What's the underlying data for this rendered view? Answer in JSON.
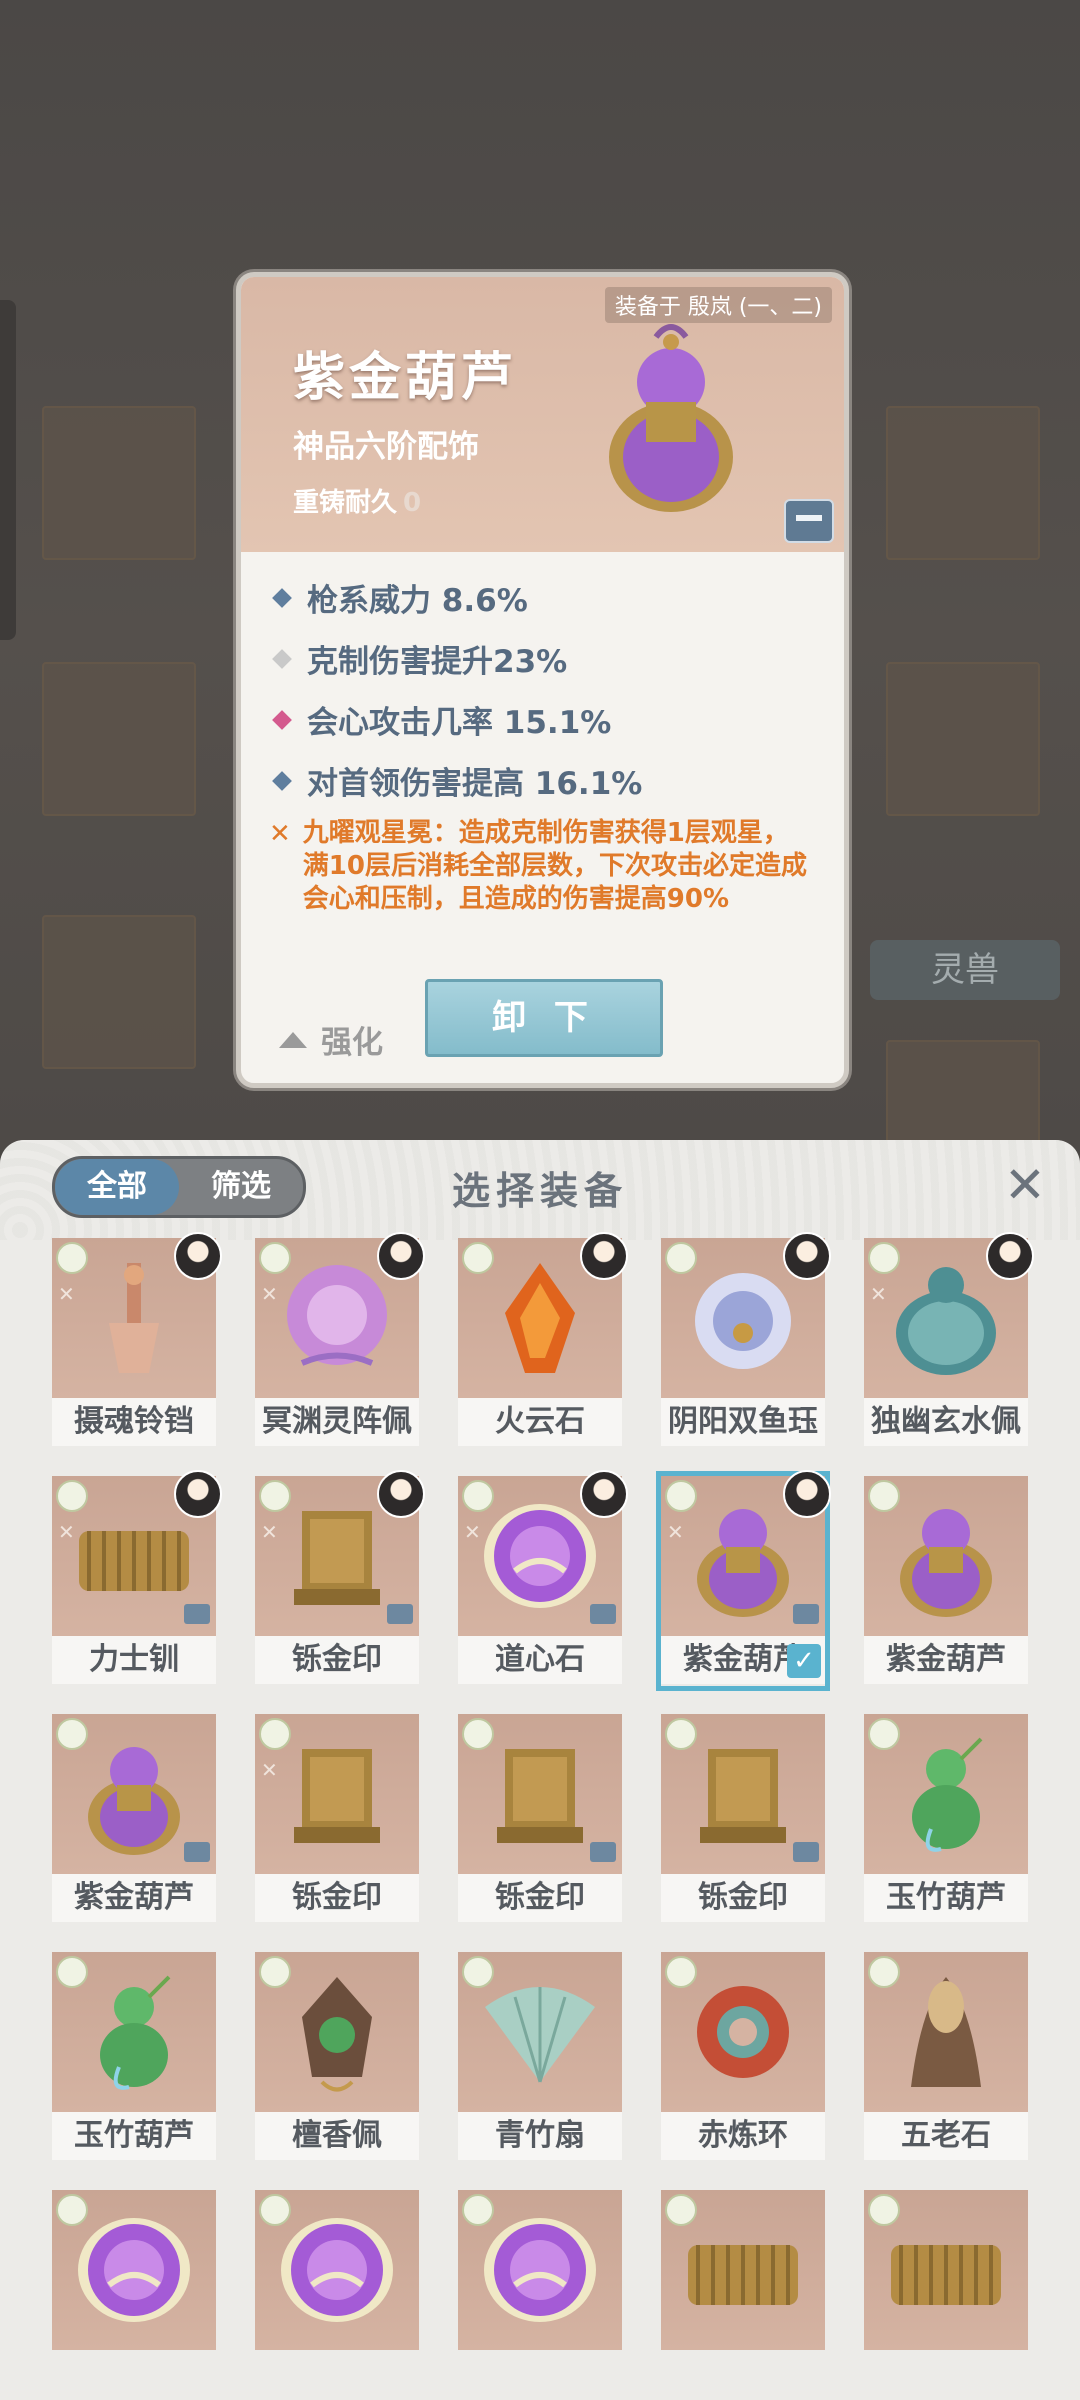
{
  "background": {
    "side_button_label": "灵兽"
  },
  "detail": {
    "equipped_by": "装备于 殷岚 (一、二)",
    "name": "紫金葫芦",
    "grade": "神品六阶配饰",
    "durability_label": "重铸耐久",
    "durability_value": "0",
    "stats": [
      {
        "text": "枪系威力 8.6%",
        "color": "#5f7e9e"
      },
      {
        "text": "克制伤害提升23%",
        "color": "#c9c9c9"
      },
      {
        "text": "会心攻击几率 15.1%",
        "color": "#d45a8e"
      },
      {
        "text": "对首领伤害提高 16.1%",
        "color": "#5f7e9e"
      }
    ],
    "set_effect": "九曜观星冕：造成克制伤害获得1层观星，满10层后消耗全部层数，下次攻击必定造成会心和压制，且造成的伤害提高90%",
    "enhance_label": "强化",
    "unequip_label": "卸 下"
  },
  "panel": {
    "tabs": [
      "全部",
      "筛选"
    ],
    "title": "选择装备",
    "close_icon": "close-icon",
    "items": [
      {
        "label": "摄魂铃铛",
        "art": "bell",
        "char": true,
        "mark": true,
        "lock": false,
        "selected": false
      },
      {
        "label": "冥渊灵阵佩",
        "art": "gear",
        "char": true,
        "mark": true,
        "lock": false,
        "selected": false
      },
      {
        "label": "火云石",
        "art": "fire",
        "char": true,
        "mark": false,
        "lock": false,
        "selected": false
      },
      {
        "label": "阴阳双鱼珏",
        "art": "yinyang",
        "char": true,
        "mark": false,
        "lock": false,
        "selected": false
      },
      {
        "label": "独幽玄水佩",
        "art": "jar",
        "char": true,
        "mark": true,
        "lock": false,
        "selected": false
      },
      {
        "label": "力士钏",
        "art": "spring",
        "char": true,
        "mark": true,
        "lock": true,
        "selected": false
      },
      {
        "label": "铄金印",
        "art": "seal",
        "char": true,
        "mark": true,
        "lock": true,
        "selected": false
      },
      {
        "label": "道心石",
        "art": "orb",
        "char": true,
        "mark": true,
        "lock": true,
        "selected": false
      },
      {
        "label": "紫金葫芦",
        "art": "gourd",
        "char": true,
        "mark": true,
        "lock": true,
        "selected": true
      },
      {
        "label": "紫金葫芦",
        "art": "gourd",
        "char": false,
        "mark": false,
        "lock": false,
        "selected": false
      },
      {
        "label": "紫金葫芦",
        "art": "gourd",
        "char": false,
        "mark": false,
        "lock": true,
        "selected": false
      },
      {
        "label": "铄金印",
        "art": "seal",
        "char": false,
        "mark": true,
        "lock": false,
        "selected": false
      },
      {
        "label": "铄金印",
        "art": "seal",
        "char": false,
        "mark": false,
        "lock": true,
        "selected": false
      },
      {
        "label": "铄金印",
        "art": "seal",
        "char": false,
        "mark": false,
        "lock": true,
        "selected": false
      },
      {
        "label": "玉竹葫芦",
        "art": "greengourd",
        "char": false,
        "mark": false,
        "lock": false,
        "selected": false
      },
      {
        "label": "玉竹葫芦",
        "art": "greengourd",
        "char": false,
        "mark": false,
        "lock": false,
        "selected": false
      },
      {
        "label": "檀香佩",
        "art": "pendant",
        "char": false,
        "mark": false,
        "lock": false,
        "selected": false
      },
      {
        "label": "青竹扇",
        "art": "fan",
        "char": false,
        "mark": false,
        "lock": false,
        "selected": false
      },
      {
        "label": "赤炼环",
        "art": "ring",
        "char": false,
        "mark": false,
        "lock": false,
        "selected": false
      },
      {
        "label": "五老石",
        "art": "stone",
        "char": false,
        "mark": false,
        "lock": false,
        "selected": false
      },
      {
        "label": "",
        "art": "orb",
        "char": false,
        "mark": false,
        "lock": false,
        "selected": false
      },
      {
        "label": "",
        "art": "orb",
        "char": false,
        "mark": false,
        "lock": false,
        "selected": false
      },
      {
        "label": "",
        "art": "orb",
        "char": false,
        "mark": false,
        "lock": false,
        "selected": false
      },
      {
        "label": "",
        "art": "spring",
        "char": false,
        "mark": false,
        "lock": false,
        "selected": false
      },
      {
        "label": "",
        "art": "spring",
        "char": false,
        "mark": false,
        "lock": false,
        "selected": false
      }
    ]
  }
}
